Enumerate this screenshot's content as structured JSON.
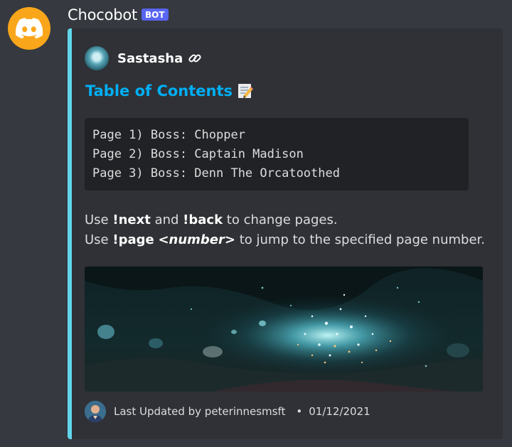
{
  "message": {
    "username": "Chocobot",
    "badge": "BOT"
  },
  "embed": {
    "accent_color": "#61d6ea",
    "author": {
      "name": "Sastasha",
      "icon": "sastasha-icon",
      "link_icon": "link-icon"
    },
    "title": "Table of Contents",
    "title_icon": "memo-icon",
    "code_lines": [
      "Page 1) Boss: Chopper",
      "Page 2) Boss: Captain Madison",
      "Page 3) Boss: Denn The Orcatoothed"
    ],
    "description": {
      "line1": {
        "use": "Use",
        "next": "!next",
        "and": "and",
        "back": "!back",
        "rest": "to change pages."
      },
      "line2": {
        "use": "Use",
        "page": "!page",
        "number": "<number>",
        "rest": "to jump to the specified page number."
      }
    },
    "image_alt": "sastasha-dungeon-image",
    "footer": {
      "text": "Last Updated by peterinnesmsft",
      "separator": "•",
      "date": "01/12/2021"
    }
  },
  "colors": {
    "background": "#36393f",
    "embed_bg": "#2f3136",
    "title_link": "#00aff4",
    "bot_badge": "#5865f2",
    "avatar_bg": "#faa61a"
  }
}
